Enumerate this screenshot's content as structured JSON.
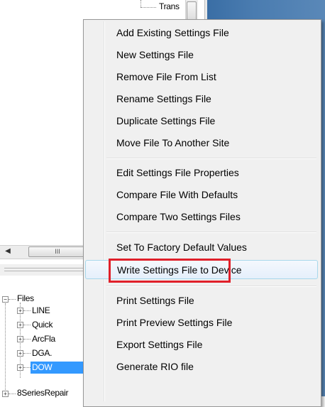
{
  "tree_top": {
    "partial_node_label": "Trans"
  },
  "hscroll": {
    "thumb_grip": "III"
  },
  "tree_bottom": {
    "root_label": "Files",
    "children": [
      "LINE",
      "Quick",
      "ArcFla",
      "DGA.",
      "DOW"
    ],
    "sibling_label": "8SeriesRepair"
  },
  "context_menu": {
    "groups": [
      [
        "Add Existing Settings File",
        "New Settings File",
        "Remove File From List",
        "Rename Settings File",
        "Duplicate Settings File",
        "Move File To Another Site"
      ],
      [
        "Edit Settings File Properties",
        "Compare File With Defaults",
        "Compare Two Settings Files"
      ],
      [
        "Set To Factory Default Values",
        "Write Settings File to Device"
      ],
      [
        "Print Settings File",
        "Print Preview Settings File",
        "Export Settings File",
        "Generate RIO file"
      ]
    ],
    "highlighted_item": "Write Settings File to Device",
    "highlight_color": "#e0202a"
  },
  "colors": {
    "selection": "#3399ff",
    "desktop": "#4a7cb0"
  }
}
